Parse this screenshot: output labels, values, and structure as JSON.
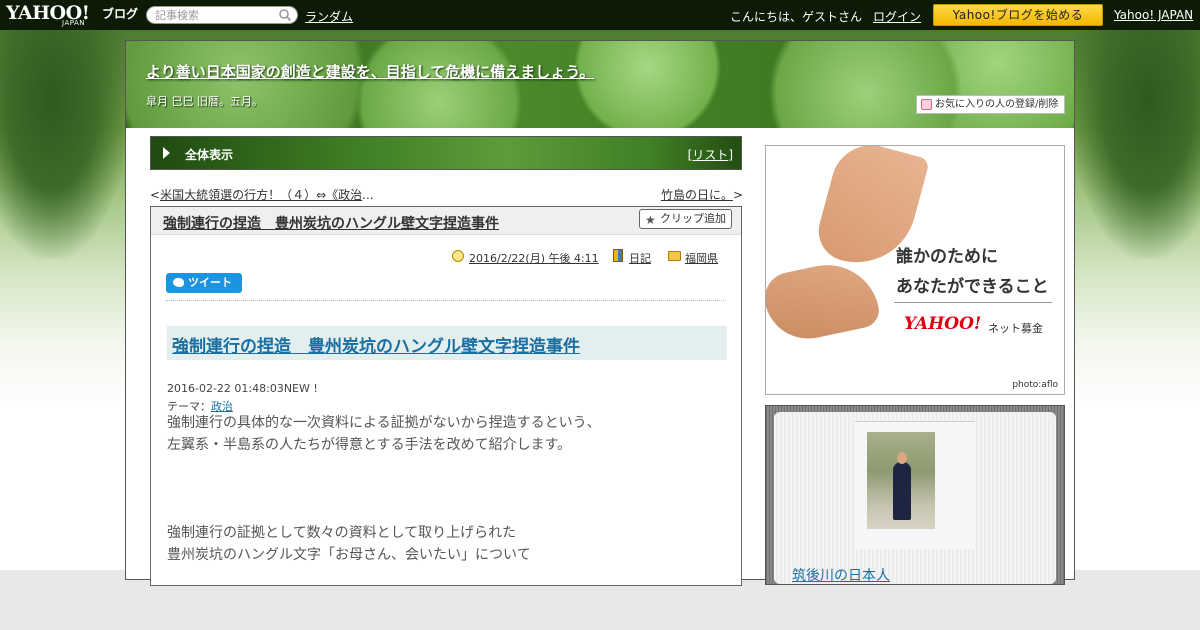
{
  "topbar": {
    "logo": "YAHOO!",
    "logo_japan": "JAPAN",
    "logo_sub": "ブログ",
    "search_placeholder": "記事検索",
    "random_link": "ランダム",
    "greeting": "こんにちは、ゲストさん",
    "login_link": "ログイン",
    "start_button": "Yahoo!ブログを始める",
    "yahoo_japan_link": "Yahoo! JAPAN"
  },
  "header": {
    "blog_title": "より善い日本国家の創造と建設を、目指して危機に備えましょう。",
    "description": "皐月 巳巳 旧暦。五月。",
    "fav_button": "お気に入りの人の登録/削除"
  },
  "nav": {
    "all_view": "全体表示",
    "list_open": "[",
    "list_link": "リスト",
    "list_close": "]"
  },
  "prevnext": {
    "prev_marker": "<",
    "prev_link": "米国大統領選の行方！（４）⇔《政治",
    "prev_ellipsis": "...",
    "next_link": "竹島の日に。",
    "next_marker": ">"
  },
  "article": {
    "title": "強制連行の捏造　豊州炭坑のハングル壁文字捏造事件",
    "clip_button": "クリップ追加",
    "date_link": "2016/2/22(月) 午後 4:11",
    "category_link": "日記",
    "folder_link": "福岡県",
    "tweet_button": "ツイート",
    "body_title": "強制連行の捏造　豊州炭坑のハングル壁文字捏造事件",
    "post_date": "2016-02-22 01:48:03NEW !",
    "theme_label": "テーマ：",
    "theme_link": "政治",
    "body_lines": [
      "強制連行の具体的な一次資料による証拠がないから捏造するという、",
      "左翼系・半島系の人たちが得意とする手法を改めて紹介します。",
      "強制連行の証拠として数々の資料として取り上げられた",
      "豊州炭坑のハングル文字「お母さん、会いたい」について"
    ]
  },
  "sidebar": {
    "ad_line1": "誰かのために",
    "ad_line2": "あなたができること",
    "ad_brand": "YAHOO!",
    "ad_brand_sub": "ネット募金",
    "ad_credit": "photo:aflo",
    "profile_name": "筑後川の日本人"
  }
}
